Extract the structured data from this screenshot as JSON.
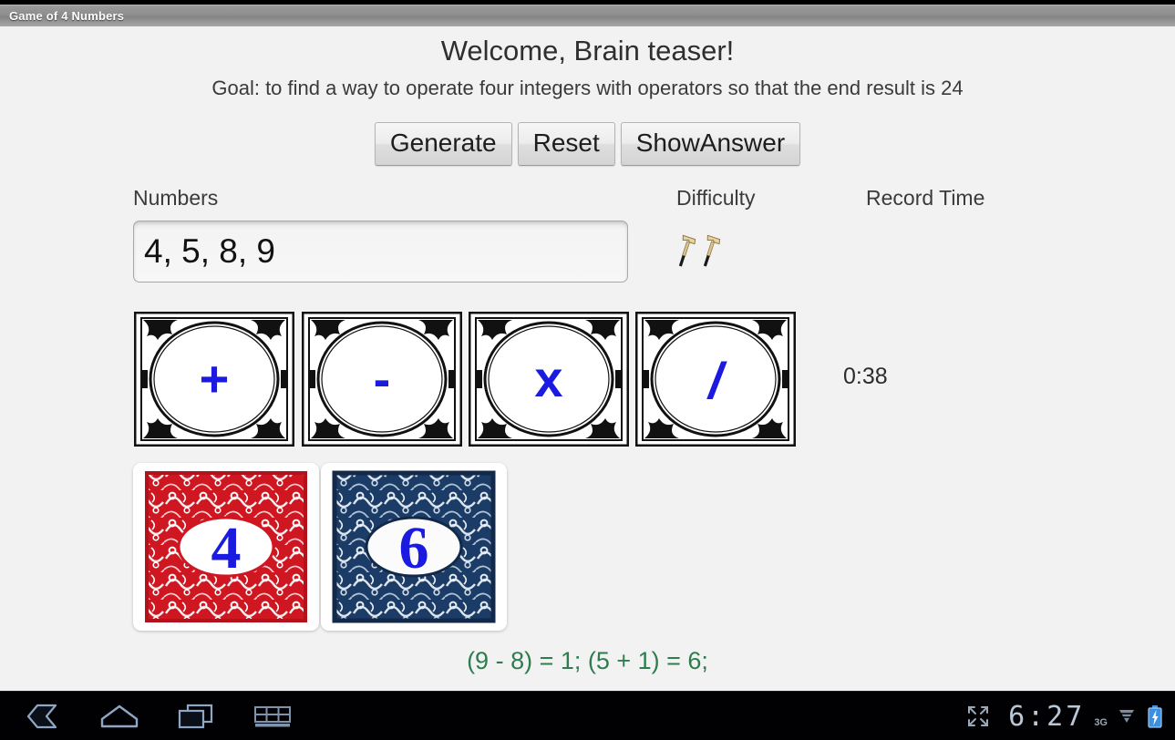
{
  "window": {
    "title": "Game of 4 Numbers"
  },
  "app": {
    "welcome": "Welcome, Brain teaser!",
    "goal": "Goal: to find a way to operate four integers with operators so that the end result is 24",
    "buttons": [
      {
        "label": "Generate",
        "name": "generate-button"
      },
      {
        "label": "Reset",
        "name": "reset-button"
      },
      {
        "label": "ShowAnswer",
        "name": "show-answer-button"
      }
    ],
    "columns": {
      "numbers_label": "Numbers",
      "difficulty_label": "Difficulty",
      "record_time_label": "Record Time"
    },
    "numbers_input": {
      "value": "4, 5, 8, 9",
      "placeholder": "4, 5, 8, 9"
    },
    "difficulty": {
      "icon": "hammer-icon",
      "count": 2
    },
    "record_time_value": "",
    "timer": "0:38",
    "operator_cards": [
      {
        "symbol": "+",
        "name": "operator-card-plus"
      },
      {
        "symbol": "-",
        "name": "operator-card-minus"
      },
      {
        "symbol": "x",
        "name": "operator-card-multiply"
      },
      {
        "symbol": "/",
        "name": "operator-card-divide"
      }
    ],
    "number_cards": [
      {
        "value": "4",
        "color": "red"
      },
      {
        "value": "6",
        "color": "blue"
      }
    ],
    "answer": "(9 - 8) = 1;   (5 + 1) = 6;",
    "colors": {
      "operator_glyph": "#1a1ae0",
      "card_red": "#cf1722",
      "card_blue": "#1b3c66",
      "answer_green": "#2e7d4f",
      "background": "#f2f2f2",
      "titlebar": "#8e8e8e"
    }
  },
  "navbar": {
    "buttons": [
      {
        "name": "back-icon",
        "label": "Back"
      },
      {
        "name": "home-icon",
        "label": "Home"
      },
      {
        "name": "recents-icon",
        "label": "Recent apps"
      },
      {
        "name": "keyboard-icon",
        "label": "Keyboard"
      }
    ],
    "status": {
      "fullscreen_icon": "expand-icon",
      "clock": "6:27",
      "network": "3G",
      "battery_icon": "battery-charging-icon"
    }
  }
}
